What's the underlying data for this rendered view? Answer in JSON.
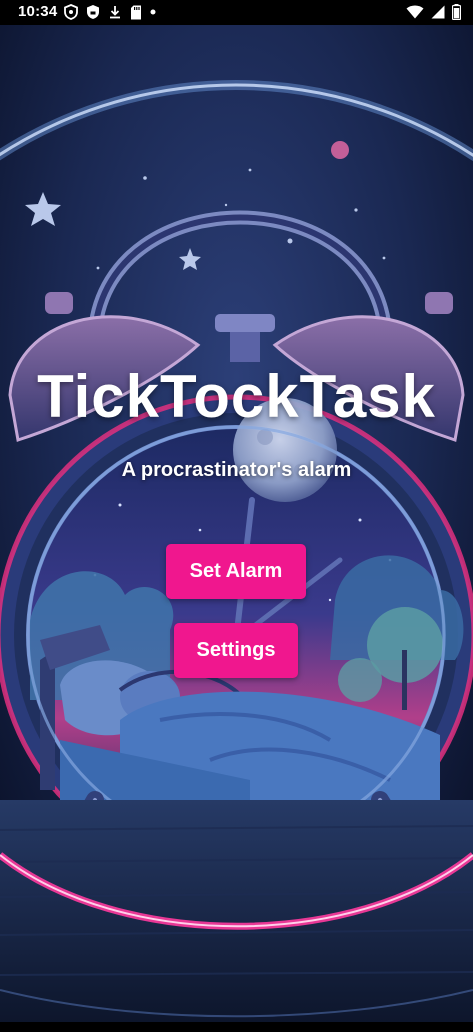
{
  "status_bar": {
    "time": "10:34",
    "left_icons": [
      "vpn-shield-icon",
      "security-shield-icon",
      "download-icon",
      "sd-card-icon",
      "notification-dot-icon"
    ],
    "right_icons": [
      "wifi-icon",
      "signal-icon",
      "battery-icon"
    ]
  },
  "app": {
    "title": "TickTockTask",
    "subtitle": "A procrastinator's alarm"
  },
  "buttons": {
    "set_alarm": "Set Alarm",
    "settings": "Settings"
  },
  "colors": {
    "button_bg": "#f0178e",
    "status_bar_bg": "#000000",
    "background_night": "#0d1530"
  }
}
